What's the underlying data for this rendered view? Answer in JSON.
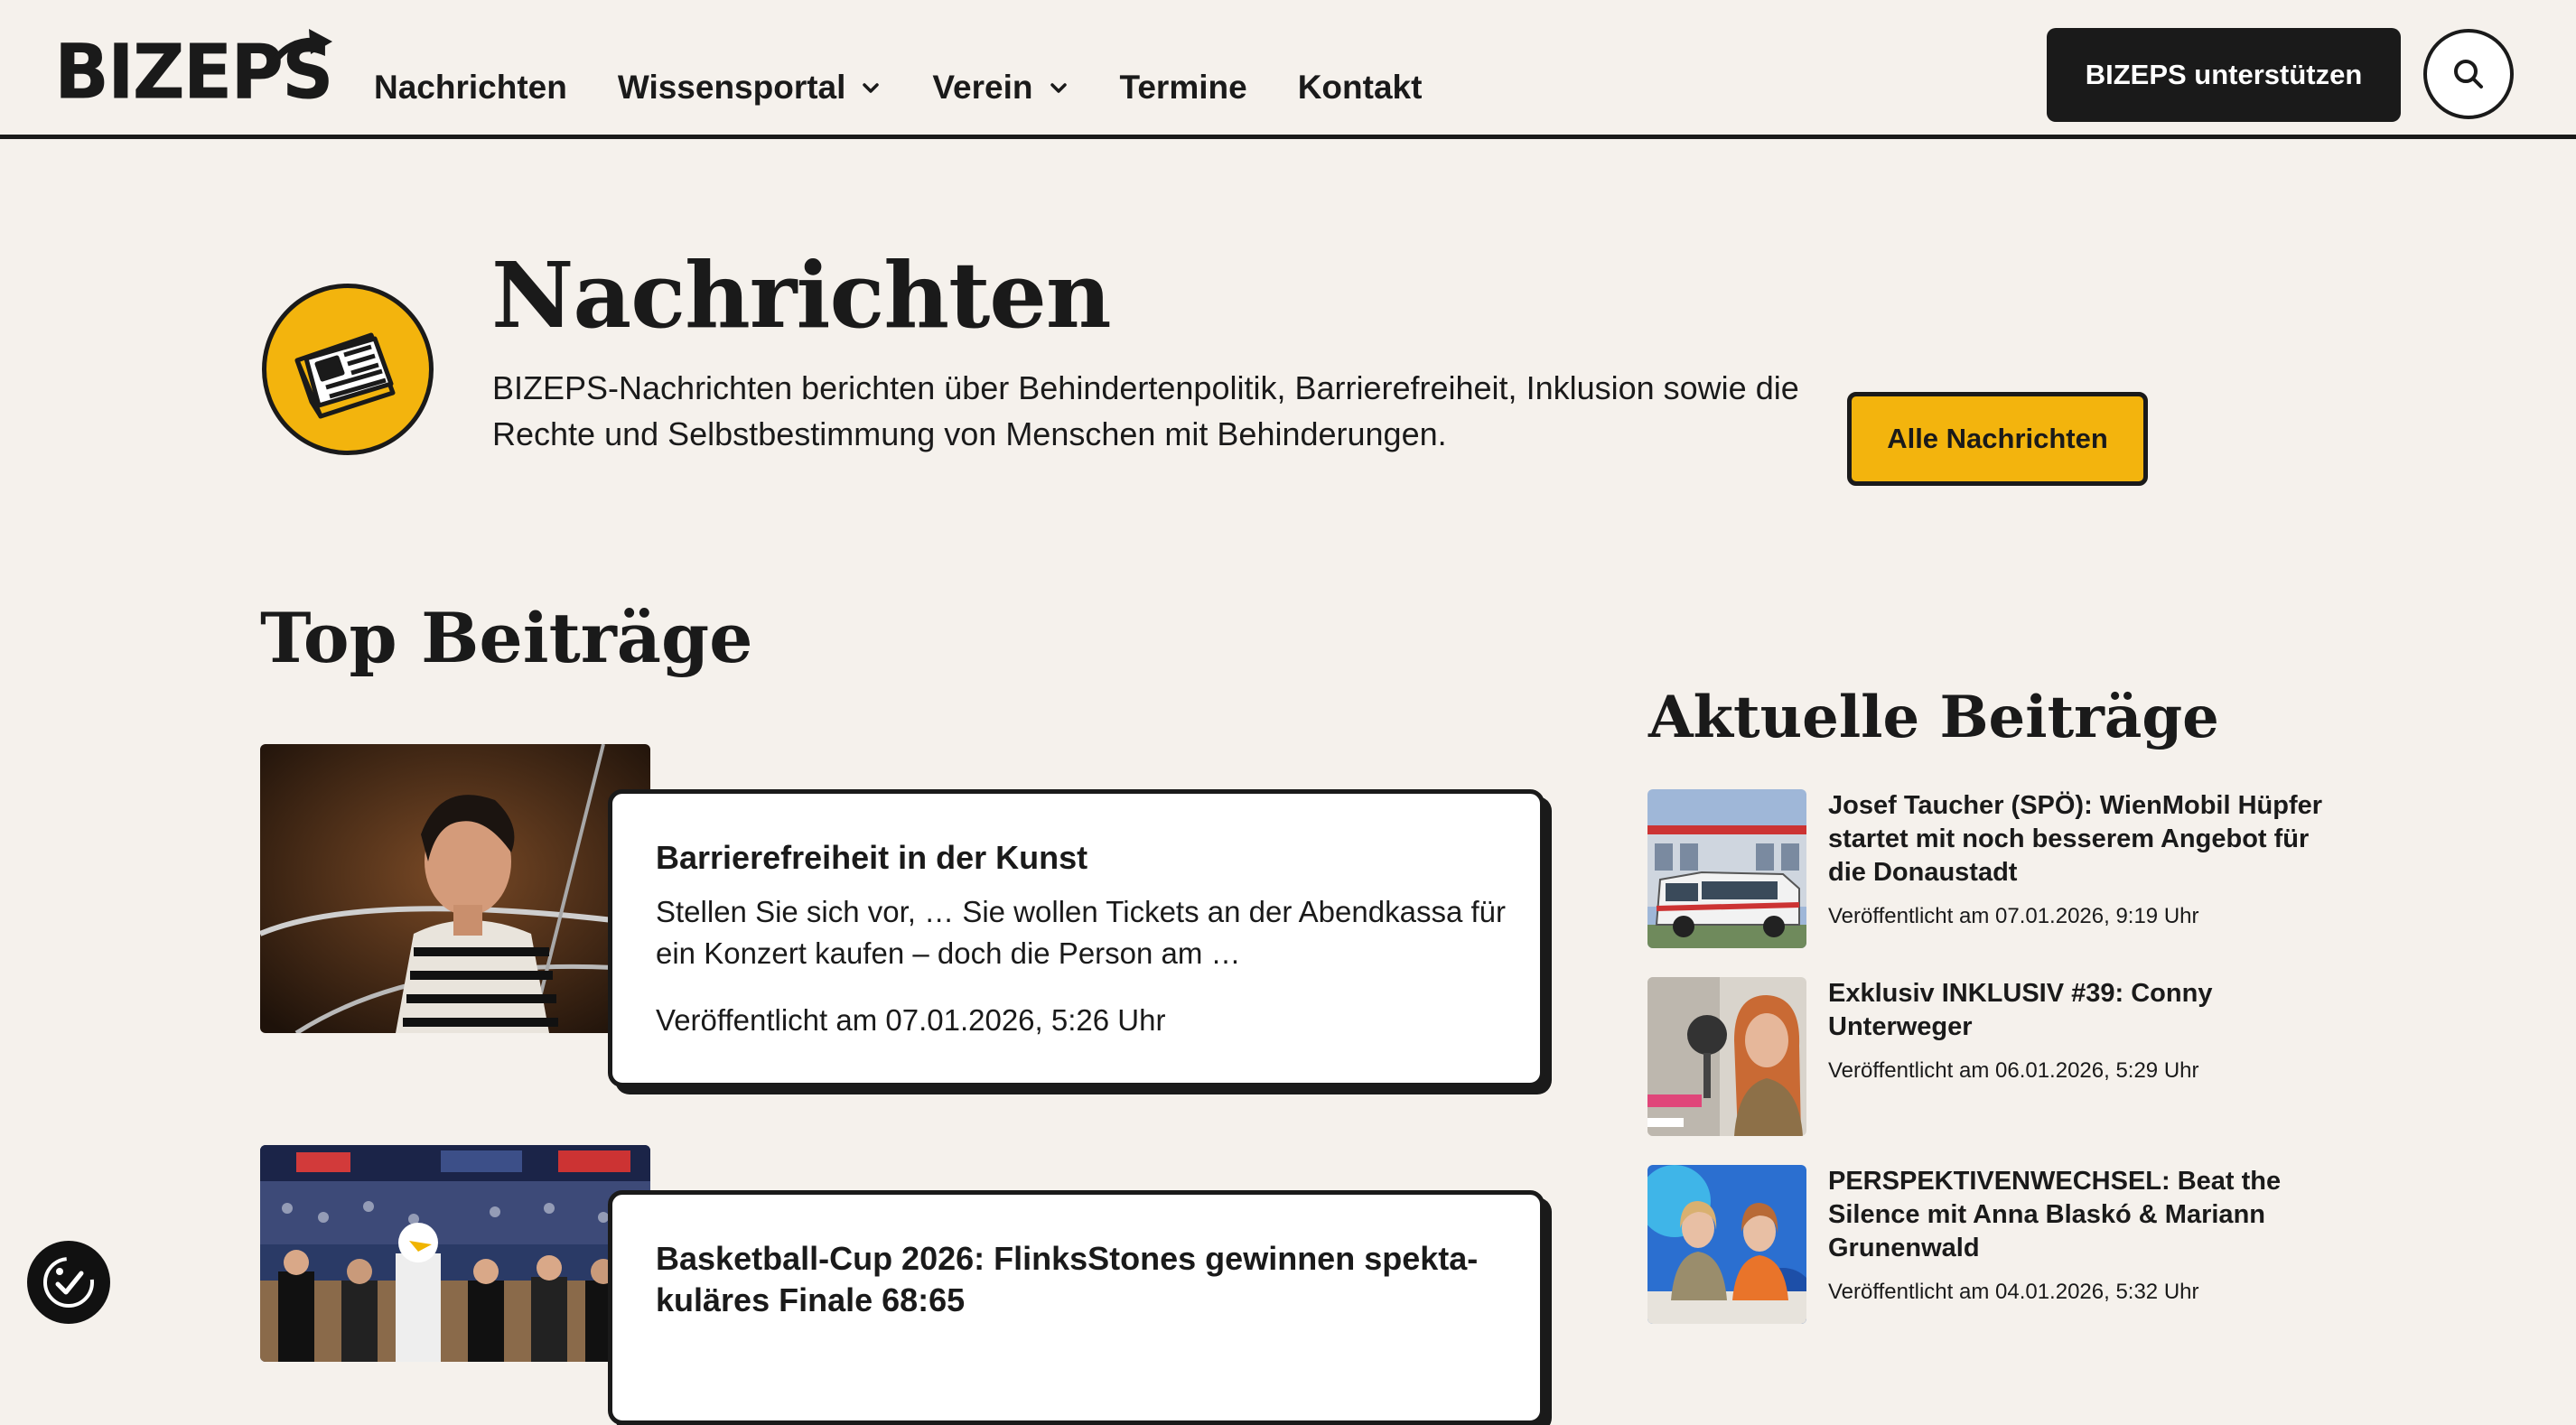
{
  "header": {
    "logo": "BIZEPS",
    "nav": [
      {
        "label": "Nachrichten",
        "has_dropdown": false
      },
      {
        "label": "Wissensportal",
        "has_dropdown": true
      },
      {
        "label": "Verein",
        "has_dropdown": true
      },
      {
        "label": "Termine",
        "has_dropdown": false
      },
      {
        "label": "Kontakt",
        "has_dropdown": false
      }
    ],
    "support_label": "BIZEPS unterstützen",
    "search_icon": "search-icon"
  },
  "intro": {
    "icon": "newspaper-icon",
    "title": "Nachrichten",
    "description": "BIZEPS-Nachrichten berichten über Behindertenpolitik, Barrierefreiheit, Inklusion sowie die Rechte und Selbstbestimmung von Menschen mit Behinderungen.",
    "all_button": "Alle Nachrichten"
  },
  "top": {
    "title": "Top Beiträge",
    "articles": [
      {
        "title": "Barrierefreiheit in der Kunst",
        "excerpt": "Stellen Sie sich vor, … Sie wollen Tickets an der Abendkassa für ein Konzert kaufen – doch die Person am …",
        "date": "Veröffentlicht am 07.01.2026, 5:26 Uhr"
      },
      {
        "title": "Basketball-Cup 2026: FlinksStones gewinnen spekta­kuläres Finale 68:65",
        "excerpt": "",
        "date": ""
      }
    ]
  },
  "recent": {
    "title": "Aktuelle Beiträge",
    "items": [
      {
        "title": "Josef Taucher (SPÖ): WienMobil Hüpfer startet mit noch besserem Angebot für die Donaustadt",
        "date": "Veröffentlicht am 07.01.2026, 9:19 Uhr"
      },
      {
        "title": "Exklusiv INKLUSIV #39: Conny Unterweger",
        "date": "Veröffentlicht am 06.01.2026, 5:29 Uhr"
      },
      {
        "title": "PERSPEKTIVENWECHSEL: Beat the Silence mit Anna Blaskó & Mariann Grunenwald",
        "date": "Veröffentlicht am 04.01.2026, 5:32 Uhr"
      }
    ]
  },
  "accessibility_icon": "accessibility-icon",
  "colors": {
    "accent": "#f3b40d",
    "background": "#f5f1ec",
    "ink": "#1a1a1a"
  }
}
